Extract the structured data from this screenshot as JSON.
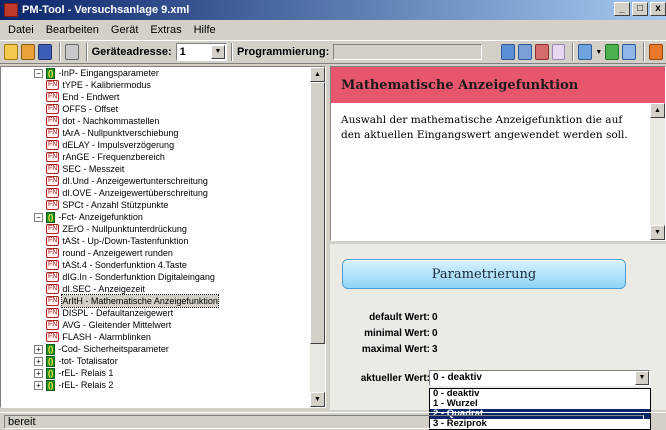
{
  "window": {
    "title": "PM-Tool - Versuchsanlage 9.xml",
    "controls": [
      "_",
      "□",
      "x"
    ]
  },
  "menu": [
    "Datei",
    "Bearbeiten",
    "Gerät",
    "Extras",
    "Hilfe"
  ],
  "toolbar": {
    "device_label": "Geräteadresse:",
    "device_value": "1",
    "prog_label": "Programmierung:"
  },
  "tree": {
    "items": [
      {
        "kind": "group",
        "level": 0,
        "expander": "−",
        "label": "-InP- Eingangsparameter"
      },
      {
        "kind": "fn",
        "level": 1,
        "label": "tYPE - Kalibriermodus"
      },
      {
        "kind": "fn",
        "level": 1,
        "label": "End - Endwert"
      },
      {
        "kind": "fn",
        "level": 1,
        "label": "OFFS - Offset"
      },
      {
        "kind": "fn",
        "level": 1,
        "label": "dot - Nachkommastellen"
      },
      {
        "kind": "fn",
        "level": 1,
        "label": "tArA - Nullpunktverschiebung"
      },
      {
        "kind": "fn",
        "level": 1,
        "label": "dELAY - Impulsverzögerung"
      },
      {
        "kind": "fn",
        "level": 1,
        "label": "rAnGE - Frequenzbereich"
      },
      {
        "kind": "fn",
        "level": 1,
        "label": "SEC - Messzeit"
      },
      {
        "kind": "fn",
        "level": 1,
        "label": "dI.Und - Anzeigewertunterschreitung"
      },
      {
        "kind": "fn",
        "level": 1,
        "label": "dI.OVE - Anzeigewertüberschreitung"
      },
      {
        "kind": "fn",
        "level": 1,
        "label": "SPCt - Anzahl Stützpunkte"
      },
      {
        "kind": "group",
        "level": 0,
        "expander": "−",
        "label": "-Fct- Anzeigefunktion"
      },
      {
        "kind": "fn",
        "level": 1,
        "label": "ZErO - Nullpunktunterdrückung"
      },
      {
        "kind": "fn",
        "level": 1,
        "label": "tASt - Up-/Down-Tastenfunktion"
      },
      {
        "kind": "fn",
        "level": 1,
        "label": "round - Anzeigewert runden"
      },
      {
        "kind": "fn",
        "level": 1,
        "label": "tASt.4 - Sonderfunktion 4.Taste"
      },
      {
        "kind": "fn",
        "level": 1,
        "label": "dIG.In - Sonderfunktion Digitaleingang"
      },
      {
        "kind": "fn",
        "level": 1,
        "label": "dI.SEC - Anzeigezeit"
      },
      {
        "kind": "fn",
        "level": 1,
        "label": "ArItH - Mathematische Anzeigefunktion",
        "selected": true
      },
      {
        "kind": "fn",
        "level": 1,
        "label": "DISPL - Defaultanzeigewert"
      },
      {
        "kind": "fn",
        "level": 1,
        "label": "AVG - Gleitender Mittelwert"
      },
      {
        "kind": "fn",
        "level": 1,
        "label": "FLASH - Alarmblinken"
      },
      {
        "kind": "group",
        "level": 0,
        "expander": "+",
        "label": "-Cod- Sicherheitsparameter"
      },
      {
        "kind": "group",
        "level": 0,
        "expander": "+",
        "label": "-tot- Totalisator"
      },
      {
        "kind": "group",
        "level": 0,
        "expander": "+",
        "label": "-rEL- Relais 1"
      },
      {
        "kind": "group",
        "level": 0,
        "expander": "+",
        "label": "-rEL- Relais 2"
      }
    ],
    "fn_badge": "FN",
    "group_badge": "()"
  },
  "detail": {
    "title": "Mathematische Anzeigefunktion",
    "description": "Auswahl der mathematische Anzeigefunktion die auf den aktuellen Eingangswert angewendet werden soll."
  },
  "params": {
    "button_label": "Parametrierung",
    "default_label": "default Wert:",
    "default_value": "0",
    "min_label": "minimal Wert:",
    "min_value": "0",
    "max_label": "maximal Wert:",
    "max_value": "3",
    "current_label": "aktueller Wert:",
    "current_value": "0 - deaktiv",
    "options": [
      "0 - deaktiv",
      "1 - Wurzel",
      "2 - Quadrat",
      "3 - Reziprok"
    ],
    "selected_index": 2
  },
  "status": {
    "text": "bereit"
  },
  "colors": {
    "header_bg": "#e8566e",
    "selection": "#0a246a",
    "group_badge": "#1e8c2a",
    "fn_badge": "#b21d1d"
  }
}
